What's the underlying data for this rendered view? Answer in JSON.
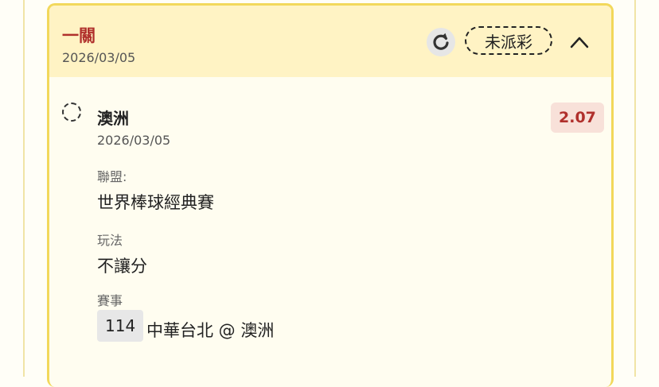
{
  "card": {
    "title": "一關",
    "date": "2026/03/05",
    "status": "未派彩",
    "icons": {
      "refresh": "refresh-icon",
      "collapse": "chevron-up-icon"
    }
  },
  "bet": {
    "team": "澳洲",
    "date": "2026/03/05",
    "odds": "2.07",
    "league_label": "聯盟:",
    "league": "世界棒球經典賽",
    "play_label": "玩法",
    "play": "不讓分",
    "event_label": "賽事",
    "game_no": "114",
    "matchup": "中華台北 @ 澳洲"
  },
  "colors": {
    "accent_red": "#b0302c",
    "header_bg": "#fff3c4",
    "border": "#f2d85b"
  }
}
